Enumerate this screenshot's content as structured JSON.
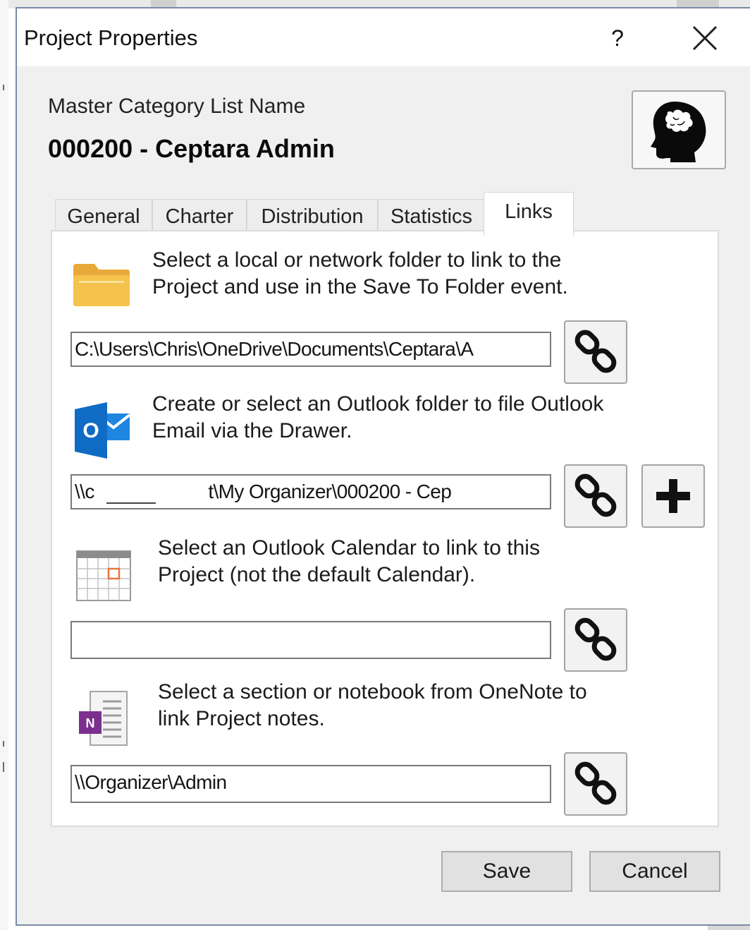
{
  "dialog": {
    "title": "Project Properties",
    "help_label": "?",
    "close_icon": "close-icon"
  },
  "header": {
    "master_label": "Master Category List Name",
    "master_value": "000200 - Ceptara Admin",
    "avatar_icon": "brain-head-icon"
  },
  "tabs": [
    {
      "label": "General",
      "active": false
    },
    {
      "label": "Charter",
      "active": false
    },
    {
      "label": "Distribution",
      "active": false
    },
    {
      "label": "Statistics",
      "active": false
    },
    {
      "label": "Links",
      "active": true
    }
  ],
  "links": {
    "folder": {
      "icon": "folder-icon",
      "line1": "Select a local or network folder to link to the",
      "line2": "Project and use in the Save To Folder event.",
      "path": "C:\\Users\\Chris\\OneDrive\\Documents\\Ceptara\\A",
      "link_icon": "chain-link-icon"
    },
    "outlook_folder": {
      "icon": "outlook-icon",
      "icon_letter": "O",
      "line1": "Create or select an Outlook folder to file Outlook",
      "line2": "Email via the Drawer.",
      "path_start": "\\\\c",
      "path_end": "t\\My Organizer\\000200 - Cep",
      "link_icon": "chain-link-icon",
      "add_icon": "plus-icon"
    },
    "calendar": {
      "icon": "calendar-icon",
      "line1": "Select an Outlook Calendar to link to this",
      "line2": "Project (not the default Calendar).",
      "path": "",
      "link_icon": "chain-link-icon"
    },
    "onenote": {
      "icon": "onenote-icon",
      "icon_letter": "N",
      "line1": "Select a section or notebook from OneNote to",
      "line2": "link Project notes.",
      "path": "\\\\Organizer\\Admin",
      "link_icon": "chain-link-icon"
    }
  },
  "footer": {
    "save_label": "Save",
    "cancel_label": "Cancel"
  },
  "colors": {
    "dialog_bg": "#f0f0f0",
    "panel_bg": "#ffffff",
    "outlook_blue": "#0f6bc4",
    "onenote_purple": "#7b2f8e",
    "folder_yellow": "#f5c24c",
    "calendar_orange": "#e8743b"
  }
}
